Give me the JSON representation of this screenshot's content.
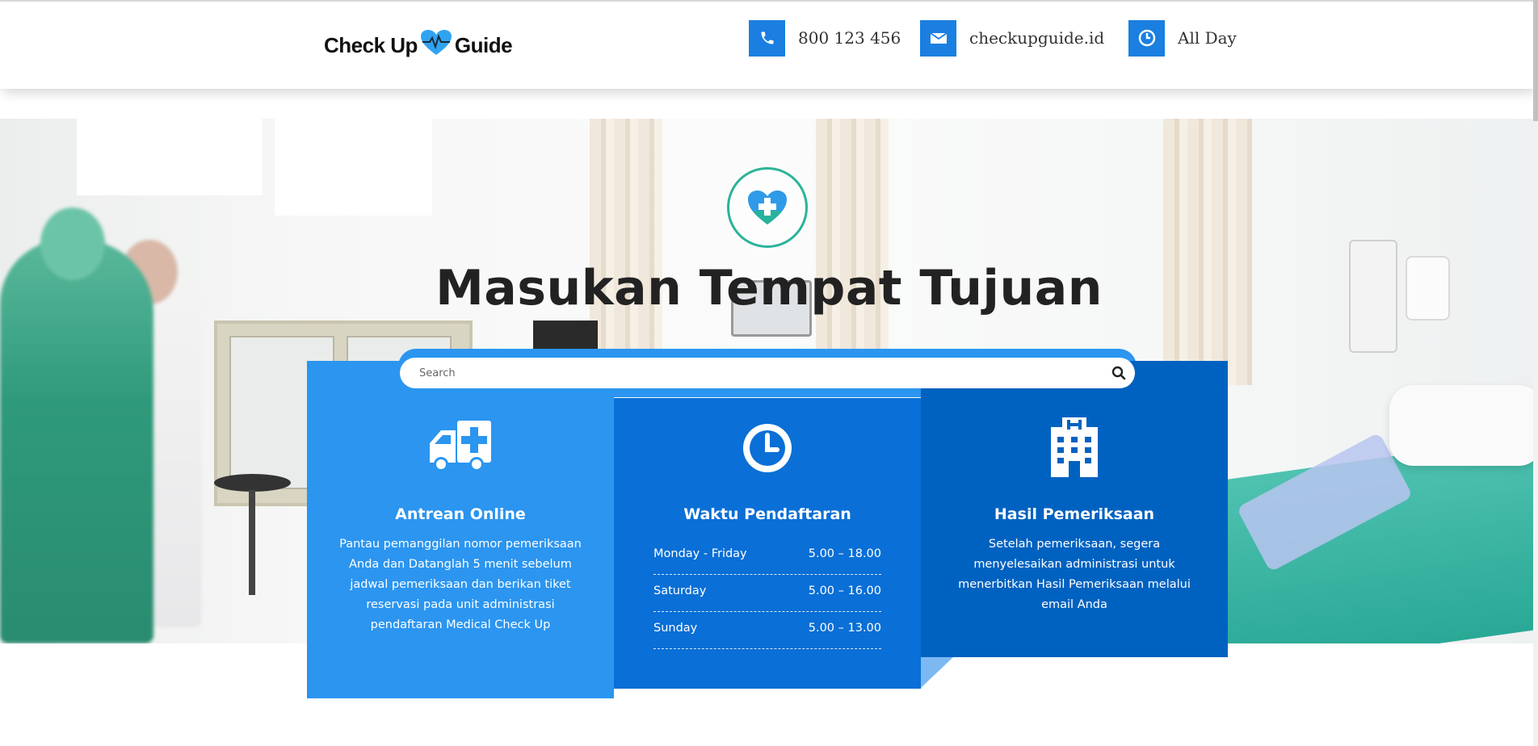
{
  "header": {
    "logo_left": "Check Up",
    "logo_right": "Guide",
    "contacts": [
      {
        "icon": "phone-icon",
        "text": "800 123 456"
      },
      {
        "icon": "envelope-icon",
        "text": "checkupguide.id"
      },
      {
        "icon": "clock-icon",
        "text": "All Day"
      }
    ]
  },
  "hero": {
    "title": "Masukan Tempat Tujuan",
    "badge_icon": "heart-plus-icon"
  },
  "search": {
    "placeholder": "Search",
    "value": ""
  },
  "cards": [
    {
      "icon": "ambulance-icon",
      "title": "Antrean Online",
      "text": "Pantau pemanggilan nomor pemeriksaan Anda dan Datanglah 5 menit sebelum jadwal pemeriksaan dan berikan tiket reservasi pada unit administrasi pendaftaran Medical Check Up"
    },
    {
      "icon": "clock-icon",
      "title": "Waktu Pendaftaran",
      "hours": [
        {
          "day": "Monday - Friday",
          "time": "5.00 – 18.00"
        },
        {
          "day": "Saturday",
          "time": "5.00 – 16.00"
        },
        {
          "day": "Sunday",
          "time": "5.00 – 13.00"
        }
      ]
    },
    {
      "icon": "hospital-icon",
      "title": "Hasil Pemeriksaan",
      "text": "Setelah pemeriksaan, segera menyelesaikan administrasi untuk menerbitkan Hasil Pemeriksaan melalui email Anda"
    }
  ],
  "colors": {
    "accent": "#1a7fe0",
    "card1": "#2b95f0",
    "card2": "#0a6fd6",
    "card3": "#0062c0",
    "badge_ring": "#2bb39a"
  }
}
